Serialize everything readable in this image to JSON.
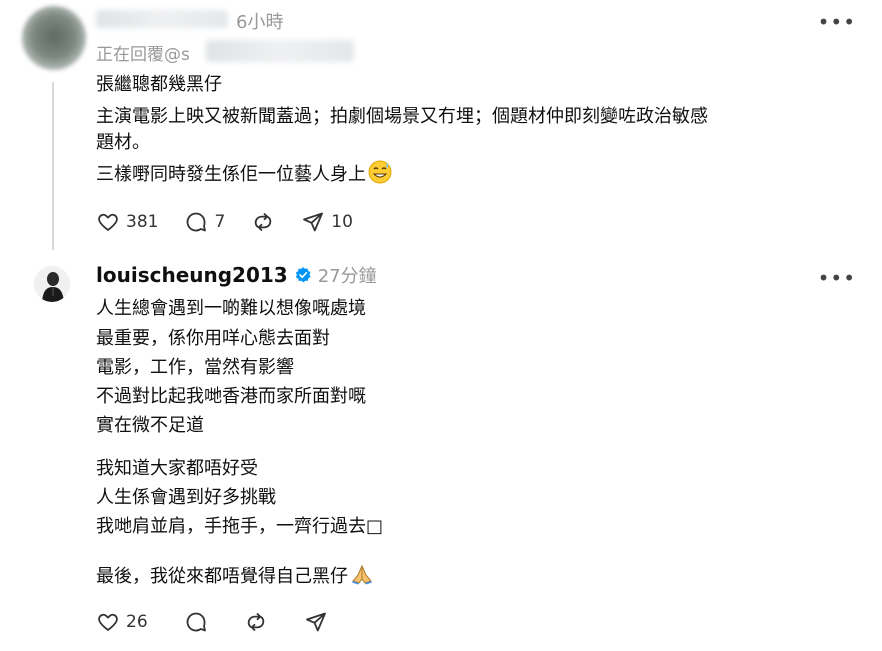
{
  "reply": {
    "time": "6小時",
    "replying_prefix": "正在回覆@s",
    "lines": [
      "張繼聰都幾黑仔",
      "主演電影上映又被新聞蓋過；拍劇個場景又冇埋；個題材仲即刻變咗政治敏感",
      "題材。",
      "三樣嘢同時發生係佢一位藝人身上"
    ],
    "emoji": "sweat-smile-emoji",
    "likes": "381",
    "comments": "7",
    "shares": "10",
    "more_icon": "more-icon"
  },
  "post": {
    "username": "louischeung2013",
    "time": "27分鐘",
    "lines": [
      "人生總會遇到一啲難以想像嘅處境",
      "最重要，係你用咩心態去面對",
      "電影，工作，當然有影響",
      "不過對比起我哋香港而家所面對嘅",
      "實在微不足道",
      "我知道大家都唔好受",
      "人生係會遇到好多挑戰",
      "我哋肩並肩，手拖手，一齊行過去",
      "最後，我從來都唔覺得自己黑仔"
    ],
    "missing_glyph": "□",
    "emoji": "folded-hands-emoji",
    "likes": "26",
    "more_icon": "more-icon"
  },
  "colors": {
    "text": "#101010",
    "muted": "#999999",
    "verified": "#0095f6",
    "line": "#d9d9d9"
  }
}
